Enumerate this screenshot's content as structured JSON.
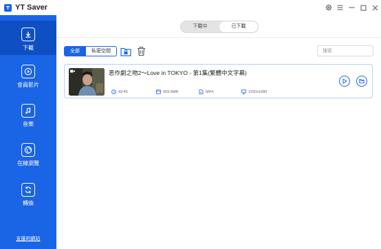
{
  "app": {
    "title": "YT Saver"
  },
  "window_controls": [
    "gear-icon",
    "menu-icon",
    "minimize-icon",
    "maximize-icon",
    "close-icon"
  ],
  "sidebar": {
    "items": [
      {
        "label": "下載",
        "icon": "download-icon",
        "active": true
      },
      {
        "label": "會員影片",
        "icon": "play-circle-icon",
        "active": false
      },
      {
        "label": "音樂",
        "icon": "music-icon",
        "active": false
      },
      {
        "label": "在線瀏覽",
        "icon": "globe-icon",
        "active": false
      },
      {
        "label": "轉換",
        "icon": "convert-icon",
        "active": false
      }
    ],
    "support_link": "支援的網站"
  },
  "tabs": {
    "downloading": "下載中",
    "downloaded": "已下載",
    "active": "downloaded"
  },
  "filters": {
    "all": "全部",
    "private": "私密空間",
    "active": "all"
  },
  "toolbar_icons": [
    "lock-folder-icon",
    "trash-icon"
  ],
  "search": {
    "placeholder": "搜索",
    "value": ""
  },
  "videos": [
    {
      "title": "恶作劇之吻2～Love in TOKYO - 第1集(繁體中文字幕)",
      "duration": "43:45",
      "size": "659.6MB",
      "format": "MP4",
      "resolution": "1920x1080"
    }
  ],
  "colors": {
    "accent": "#1a64e6",
    "sidebar_active": "#0f4fc4",
    "card_border": "#b8cff5"
  }
}
